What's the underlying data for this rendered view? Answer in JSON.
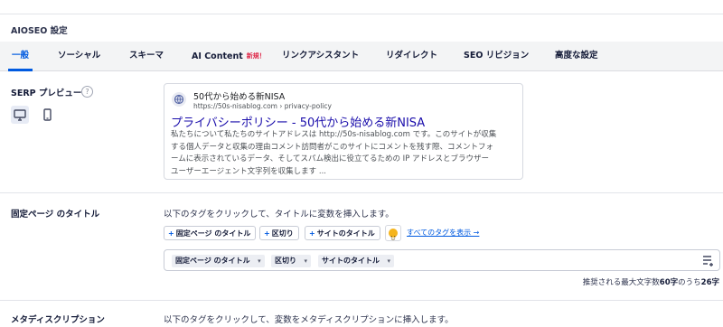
{
  "panel": {
    "title": "AIOSEO 設定"
  },
  "tabs": [
    {
      "label": "一般",
      "active": true
    },
    {
      "label": "ソーシャル"
    },
    {
      "label": "スキーマ"
    },
    {
      "label": "AI Content",
      "badge": "新規！"
    },
    {
      "label": "リンクアシスタント"
    },
    {
      "label": "リダイレクト"
    },
    {
      "label": "SEO リビジョン"
    },
    {
      "label": "高度な設定"
    }
  ],
  "serp": {
    "label": "SERP プレビュー",
    "help_icon": "question-circle-icon",
    "devices": [
      "desktop-icon",
      "mobile-icon"
    ],
    "site_name": "50代から始める新NISA",
    "url": "https://50s-nisablog.com › privacy-policy",
    "title": "プライバシーポリシー - 50代から始める新NISA",
    "desc": [
      "私たちについて私たちのサイトアドレスは http://50s-nisablog.com です。このサイトが収集",
      "する個人データと収集の理由コメント訪問者がこのサイトにコメントを残す際、コメントフォ",
      "ームに表示されているデータ、そしてスパム検出に役立てるための IP アドレスとブラウザー",
      "ユーザーエージェント文字列を収集します ..."
    ]
  },
  "page_title": {
    "label": "固定ページ のタイトル",
    "help": "以下のタグをクリックして、タイトルに変数を挿入します。",
    "tags": [
      "固定ページ のタイトル",
      "区切り",
      "サイトのタイトル"
    ],
    "show_all": "すべてのタグを表示 →",
    "editor_tags": [
      "固定ページ のタイトル",
      "区切り",
      "サイトのタイトル"
    ],
    "counter_prefix": "推奨される最大文字数",
    "counter_max": "60字",
    "counter_mid": "のうち",
    "counter_current": "26字"
  },
  "meta_desc": {
    "label": "メタディスクリプション",
    "help": "以下のタグをクリックして、変数をメタディスクリプションに挿入します。"
  },
  "colors": {
    "accent": "#005ae0",
    "badge": "#df2a4a",
    "serp_title": "#1a0dab"
  }
}
